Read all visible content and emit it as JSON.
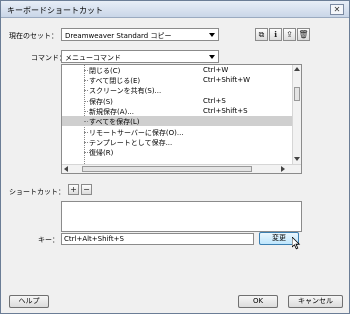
{
  "window": {
    "title": "キーボードショートカット",
    "close_glyph": "✕"
  },
  "current_set": {
    "label": "現在のセット：",
    "value": "Dreamweaver Standard コピー"
  },
  "set_buttons": [
    {
      "name": "duplicate-set-icon",
      "glyph": "⧉"
    },
    {
      "name": "info-icon",
      "glyph": "ℹ"
    },
    {
      "name": "export-icon",
      "glyph": "⇪"
    },
    {
      "name": "delete-set-icon",
      "glyph": "🗑"
    }
  ],
  "command": {
    "label": "コマンド：",
    "value": "メニューコマンド"
  },
  "commands": [
    {
      "name": "閉じる(C)",
      "shortcut": "Ctrl+W",
      "selected": false
    },
    {
      "name": "すべて閉じる(E)",
      "shortcut": "Ctrl+Shift+W",
      "selected": false
    },
    {
      "name": "スクリーンを共有(S)...",
      "shortcut": "",
      "selected": false
    },
    {
      "name": "保存(S)",
      "shortcut": "Ctrl+S",
      "selected": false
    },
    {
      "name": "新規保存(A)...",
      "shortcut": "Ctrl+Shift+S",
      "selected": false
    },
    {
      "name": "すべてを保存(L)",
      "shortcut": "",
      "selected": true
    },
    {
      "name": "リモートサーバーに保存(O)...",
      "shortcut": "",
      "selected": false
    },
    {
      "name": "テンプレートとして保存...",
      "shortcut": "",
      "selected": false
    },
    {
      "name": "復帰(R)",
      "shortcut": "",
      "selected": false
    }
  ],
  "shortcut": {
    "label": "ショートカット：",
    "add_glyph": "+",
    "remove_glyph": "−"
  },
  "key": {
    "label": "キー：",
    "value": "Ctrl+Alt+Shift+S",
    "change_label": "変更"
  },
  "footer": {
    "help_label": "ヘルプ",
    "ok_label": "OK",
    "cancel_label": "キャンセル"
  }
}
